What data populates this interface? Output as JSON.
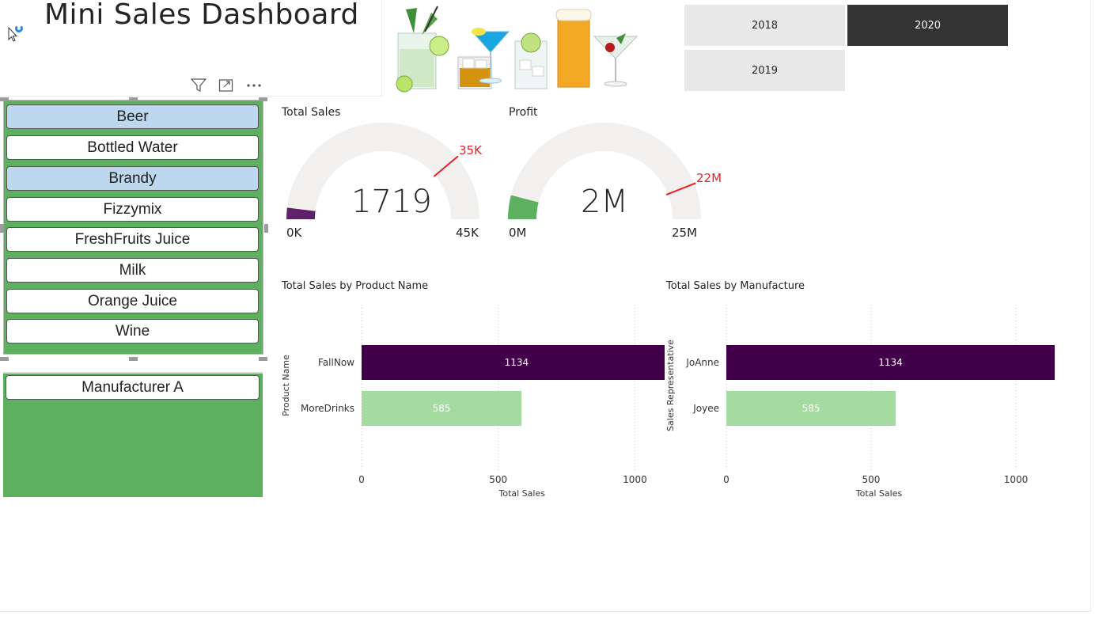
{
  "dashboard": {
    "title": "Mini Sales Dashboard"
  },
  "image": {
    "icon": "cocktails-drinks-image"
  },
  "year_slicer": {
    "options": [
      {
        "label": "2018",
        "selected": false
      },
      {
        "label": "2020",
        "selected": true
      },
      {
        "label": "2019",
        "selected": false
      }
    ]
  },
  "product_slicer": {
    "items": [
      {
        "label": "Beer",
        "selected": true
      },
      {
        "label": "Bottled Water",
        "selected": false
      },
      {
        "label": "Brandy",
        "selected": true
      },
      {
        "label": "Fizzymix",
        "selected": false
      },
      {
        "label": "FreshFruits Juice",
        "selected": false
      },
      {
        "label": "Milk",
        "selected": false
      },
      {
        "label": "Orange Juice",
        "selected": false
      },
      {
        "label": "Wine",
        "selected": false
      }
    ]
  },
  "manufacturer_slicer": {
    "items": [
      {
        "label": "Manufacturer A",
        "selected": false
      }
    ]
  },
  "colors": {
    "panel_green": "#5cb060",
    "selected_item": "#bdd7ee",
    "dark_purple": "#42004a",
    "light_green": "#a5dba0",
    "gauge_bg": "#f1f0ef",
    "target_red": "#e8202a",
    "sales_gauge_fill": "#5c2368",
    "profit_gauge_fill": "#5cb060"
  },
  "gauges": {
    "total_sales": {
      "title": "Total Sales",
      "value": 1719,
      "value_label": "1719",
      "min_label": "0K",
      "max_label": "45K",
      "target_label": "35K",
      "min": 0,
      "max": 45000,
      "target": 35000
    },
    "profit": {
      "title": "Profit",
      "value": 2000000,
      "value_label": "2M",
      "min_label": "0M",
      "max_label": "25M",
      "target_label": "22M",
      "min": 0,
      "max": 25000000,
      "target": 22000000
    }
  },
  "chart_data": [
    {
      "type": "bar",
      "title": "Total Sales by Product Name",
      "xlabel": "Total Sales",
      "ylabel": "Product Name",
      "categories": [
        "FallNow",
        "MoreDrinks"
      ],
      "values": [
        1134,
        585
      ],
      "data_labels": [
        "1134",
        "585"
      ],
      "xlim": [
        0,
        1100
      ],
      "xticks": [
        0,
        500,
        1000
      ],
      "grid": true
    },
    {
      "type": "bar",
      "title": "Total Sales by Manufacture",
      "xlabel": "Total Sales",
      "ylabel": "Sales Representative",
      "categories": [
        "JoAnne",
        "Joyee"
      ],
      "values": [
        1134,
        585
      ],
      "data_labels": [
        "1134",
        "585"
      ],
      "xlim": [
        0,
        1134
      ],
      "xticks": [
        0,
        500,
        1000
      ],
      "grid": true
    }
  ]
}
